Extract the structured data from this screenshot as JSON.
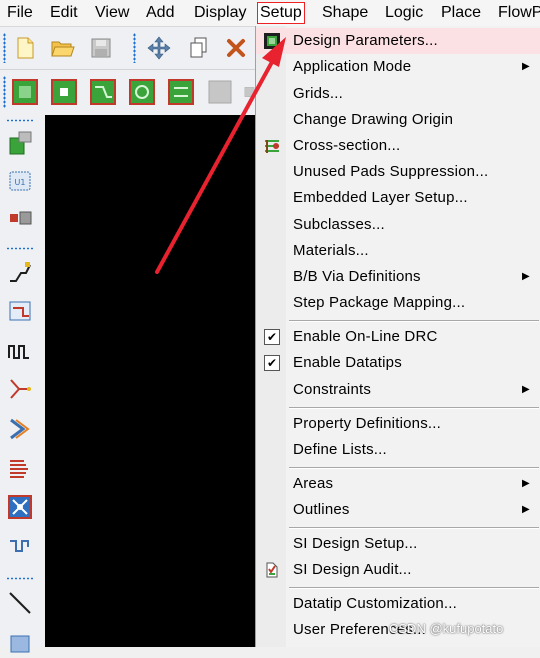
{
  "menubar": {
    "items": [
      {
        "label": "File",
        "key": "F"
      },
      {
        "label": "Edit",
        "key": "E"
      },
      {
        "label": "View",
        "key": "V"
      },
      {
        "label": "Add",
        "key": "A"
      },
      {
        "label": "Display",
        "key": "D"
      },
      {
        "label": "Setup",
        "key": "u",
        "active": true
      },
      {
        "label": "Shape",
        "key": "S"
      },
      {
        "label": "Logic",
        "key": "L"
      },
      {
        "label": "Place",
        "key": "P"
      },
      {
        "label": "FlowPl",
        "key": "F"
      }
    ]
  },
  "setup_menu": {
    "items": [
      {
        "label": "Design Parameters...",
        "icon": "design-parameters-icon",
        "highlighted": true
      },
      {
        "label": "Application Mode",
        "submenu": true
      },
      {
        "label": "Grids..."
      },
      {
        "label": "Change Drawing Origin"
      },
      {
        "label": "Cross-section...",
        "icon": "cross-section-icon"
      },
      {
        "label": "Unused Pads Suppression..."
      },
      {
        "label": "Embedded Layer Setup..."
      },
      {
        "label": "Subclasses..."
      },
      {
        "label": "Materials..."
      },
      {
        "label": "B/B Via Definitions",
        "submenu": true
      },
      {
        "label": "Step Package Mapping..."
      },
      {
        "label": "Enable On-Line DRC",
        "checked": true
      },
      {
        "label": "Enable Datatips",
        "checked": true
      },
      {
        "label": "Constraints",
        "submenu": true
      },
      {
        "label": "Property Definitions..."
      },
      {
        "label": "Define Lists..."
      },
      {
        "label": "Areas",
        "submenu": true
      },
      {
        "label": "Outlines",
        "submenu": true
      },
      {
        "label": "SI Design Setup..."
      },
      {
        "label": "SI Design Audit...",
        "icon": "si-audit-icon"
      },
      {
        "label": "Datatip Customization..."
      },
      {
        "label": "User Preferences..."
      }
    ]
  },
  "colors": {
    "accent_red": "#e8222e",
    "highlight": "#fbe1e3",
    "canvas": "#000000"
  },
  "watermark": "CSDN @kufupotato"
}
